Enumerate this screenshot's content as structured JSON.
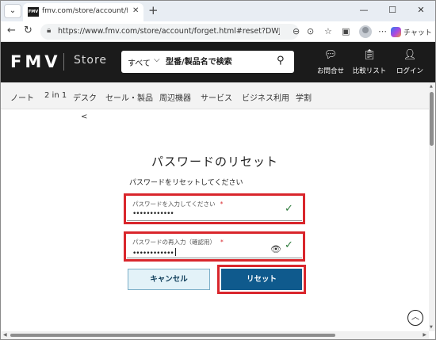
{
  "browser": {
    "tab_menu_icon": "chevron-down-icon",
    "tab": {
      "favicon_text": "FMV",
      "title": "fmv.com/store/account/forget.html"
    },
    "new_tab_glyph": "+",
    "window": {
      "minimize": "—",
      "maximize": "☐",
      "close": "✕"
    },
    "address": "https://www.fmv.com/store/account/forget.html#reset?DWJsrNbCdRsz...",
    "chat_label": "チャット"
  },
  "header": {
    "logo": "FMV",
    "store": "Store",
    "search": {
      "category": "すべて",
      "placeholder": "型番/製品名で検索"
    },
    "links": [
      {
        "label": "お問合せ",
        "icon": "chat-bubble-icon"
      },
      {
        "label": "比較リスト",
        "icon": "clipboard-list-icon"
      },
      {
        "label": "ログイン",
        "icon": "user-icon"
      }
    ],
    "accent_color": "#1b1b1b"
  },
  "nav": {
    "items": [
      "ノート",
      "2 in 1",
      "デスク",
      "セール・製品",
      "周辺機器",
      "サービス",
      "ビジネス利用",
      "学割"
    ]
  },
  "page": {
    "back_glyph": "<",
    "title": "パスワードのリセット",
    "subtitle": "パスワードをリセットしてください",
    "fields": [
      {
        "label": "パスワードを入力してください",
        "required_mark": "*",
        "value": "••••••••••••",
        "valid": true
      },
      {
        "label": "パスワードの再入力（確認用）",
        "required_mark": "*",
        "value": "••••••••••••",
        "valid": true
      }
    ],
    "cancel_label": "キャンセル",
    "reset_label": "リセット",
    "highlight_color": "#d9262c",
    "primary_color": "#0f5a8d"
  }
}
